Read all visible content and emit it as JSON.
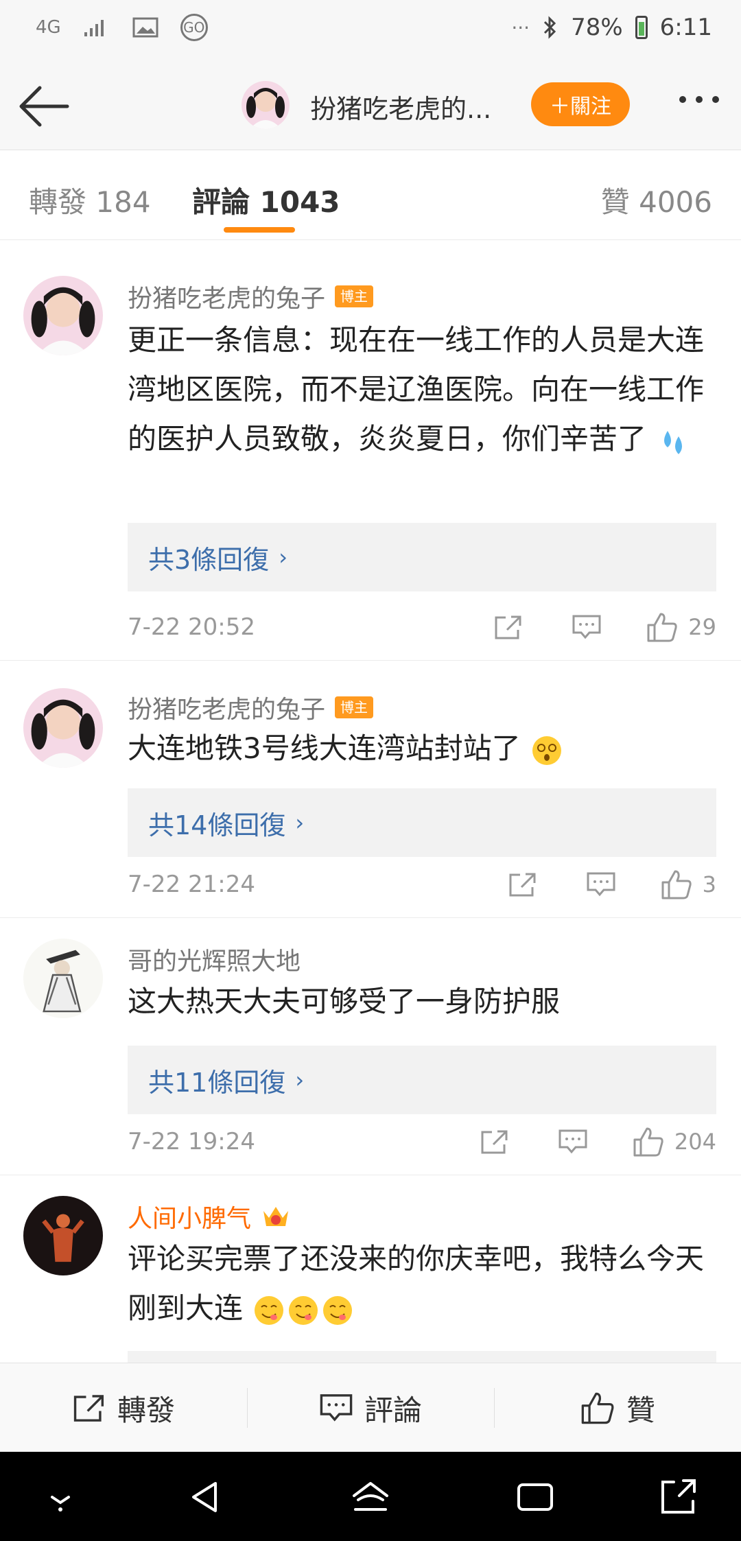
{
  "status_bar": {
    "network": "4G",
    "go_label": "GO",
    "dots": "···",
    "battery": "78%",
    "time": "6:11"
  },
  "header": {
    "title": "扮猪吃老虎的...",
    "follow_label": "＋關注"
  },
  "tabs": [
    {
      "label": "轉發",
      "count": "184"
    },
    {
      "label": "評論",
      "count": "1043"
    },
    {
      "label": "贊",
      "count": "4006"
    }
  ],
  "comments": [
    {
      "author": "扮猪吃老虎的兔子",
      "badge": "博主",
      "text": "更正一条信息：现在在一线工作的人员是大连湾地区医院，而不是辽渔医院。向在一线工作的医护人员致敬，炎炎夏日，你们辛苦了",
      "replies": "共3條回復",
      "time": "7-22 20:52",
      "likes": "29"
    },
    {
      "author": "扮猪吃老虎的兔子",
      "badge": "博主",
      "text": "大连地铁3号线大连湾站封站了",
      "replies": "共14條回復",
      "time": "7-22 21:24",
      "likes": "3"
    },
    {
      "author": "哥的光辉照大地",
      "badge": "",
      "text": "这大热天大夫可够受了一身防护服",
      "replies": "共11條回復",
      "time": "7-22 19:24",
      "likes": "204"
    },
    {
      "author": "人间小脾气",
      "badge": "",
      "text": "评论买完票了还没来的你庆幸吧，我特么今天刚到大连"
    }
  ],
  "bottom_bar": {
    "repost": "轉發",
    "comment": "評論",
    "like": "贊"
  },
  "colors": {
    "accent": "#ff8a10",
    "link": "#3d6eab"
  }
}
